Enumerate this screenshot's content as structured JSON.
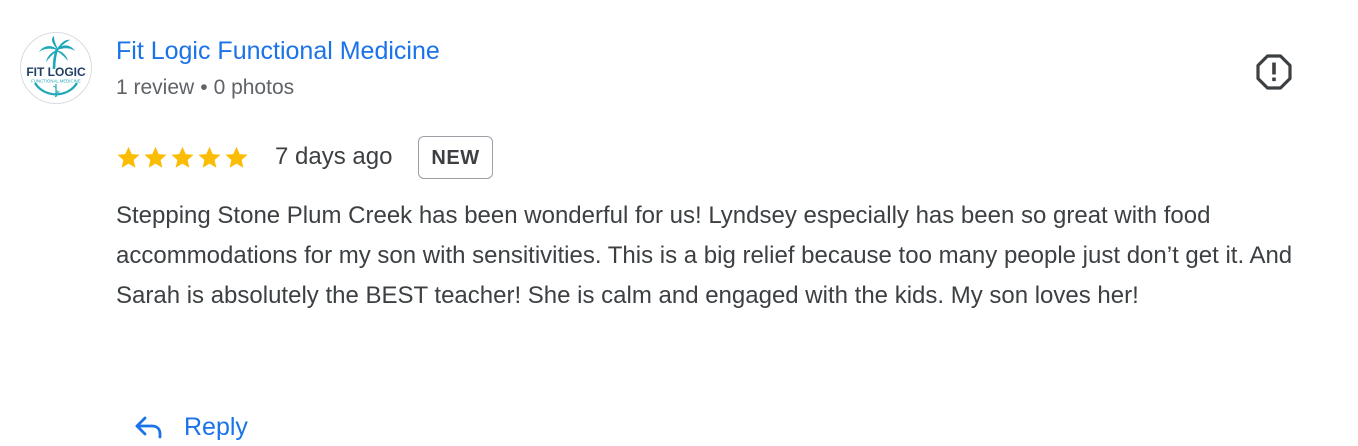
{
  "reviewer": {
    "name": "Fit Logic Functional Medicine",
    "review_count": "1 review",
    "separator": "•",
    "photo_count": "0 photos",
    "avatar": {
      "logo_text_main": "FIT LOGIC",
      "logo_text_sub": "FUNCTIONAL MEDICINE"
    }
  },
  "review": {
    "rating": 5,
    "rating_max": 5,
    "time_ago": "7 days ago",
    "badge": "NEW",
    "text": "Stepping Stone Plum Creek has been wonderful for us! Lyndsey especially has been so great with food accommodations for my son with sensitivities. This is a big relief because too many people just don’t get it. And Sarah is absolutely the BEST teacher! She is calm and engaged with the kids. My son loves her!"
  },
  "actions": {
    "reply_label": "Reply",
    "report_icon": "report-flag-icon"
  },
  "colors": {
    "link": "#1a73e8",
    "star": "#fbbc04",
    "text": "#3c4043",
    "meta": "#5f6368",
    "logo_teal": "#1ea7b8"
  }
}
